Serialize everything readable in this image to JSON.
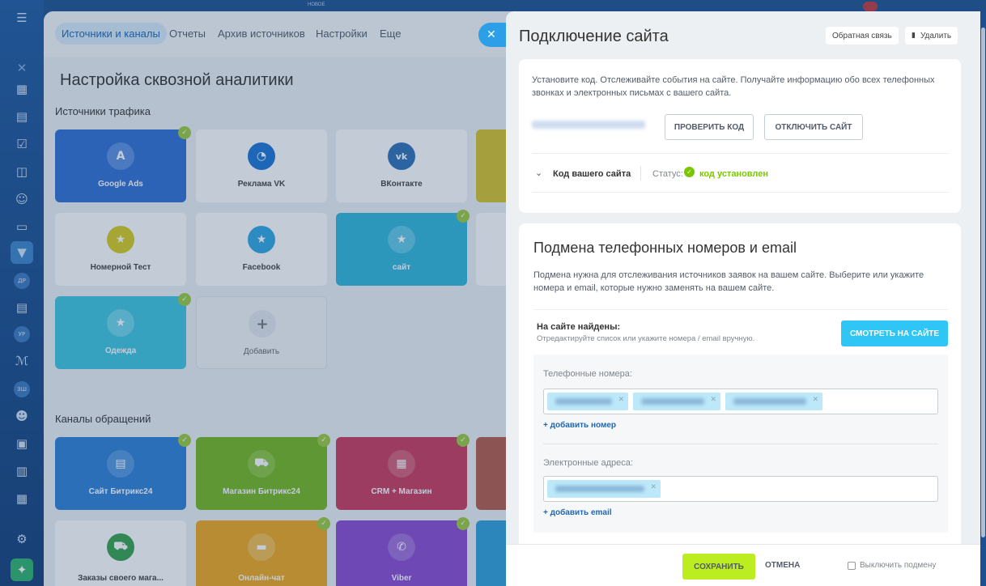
{
  "sidebar": {
    "badges": [
      "ДР",
      "УР",
      "ЗШ"
    ]
  },
  "topstrip": {
    "label": "НОВОЕ"
  },
  "background": {
    "tabs": [
      "Источники и каналы",
      "Отчеты",
      "Архив источников",
      "Настройки",
      "Еще"
    ],
    "title": "Настройка сквозной аналитики",
    "traffic_title": "Источники трафика",
    "channels_title": "Каналы обращений",
    "traffic_tiles": [
      "Google Ads",
      "Реклама VK",
      "ВКонтакте",
      "Номерной Тест",
      "Facebook",
      "сайт",
      "Одежда",
      "Добавить"
    ],
    "channel_tiles": [
      "Сайт Битрикс24",
      "Магазин Битрикс24",
      "CRM + Магазин",
      "Заказы своего мага...",
      "Онлайн-чат",
      "Viber"
    ]
  },
  "slider": {
    "title": "Подключение сайта",
    "feedback_button": "Обратная связь",
    "delete_button": "Удалить",
    "install": {
      "description": "Установите код. Отслеживайте события на сайте. Получайте информацию обо всех телефонных звонках и электронных письмах с вашего сайта.",
      "check_code": "ПРОВЕРИТЬ КОД",
      "disconnect": "ОТКЛЮЧИТЬ САЙТ",
      "code_label": "Код вашего сайта",
      "status_label": "Статус:",
      "status_value": "код установлен"
    },
    "replace": {
      "title": "Подмена телефонных номеров и email",
      "description": "Подмена нужна для отслеживания источников заявок на вашем сайте. Выберите или укажите номера и email, которые нужно заменять на вашем сайте.",
      "found_title": "На сайте найдены:",
      "found_sub": "Отредактируйте список или укажите номера / email вручную.",
      "view_on_site": "СМОТРЕТЬ НА САЙТЕ",
      "phones_label": "Телефонные номера:",
      "add_phone": "добавить номер",
      "emails_label": "Электронные адреса:",
      "add_email": "добавить email"
    },
    "footer": {
      "save": "СОХРАНИТЬ",
      "cancel": "ОТМЕНА",
      "disable": "Выключить подмену"
    }
  },
  "colors": {
    "accent": "#2fc6f6",
    "save": "#bbed21",
    "status_ok": "#77c800",
    "link": "#2067b0"
  }
}
